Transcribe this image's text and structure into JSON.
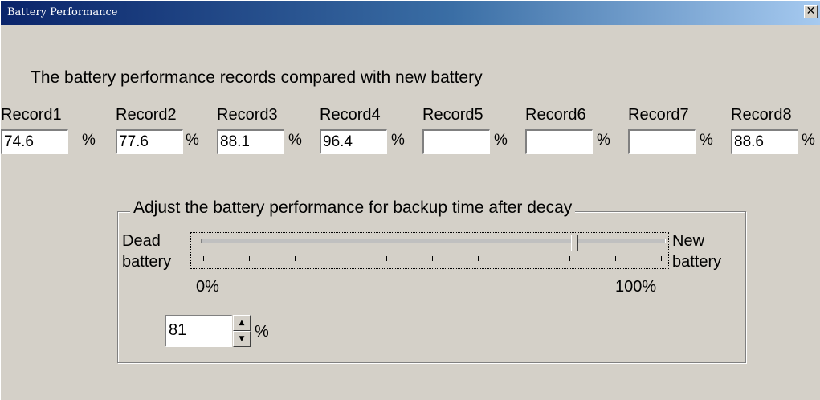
{
  "window": {
    "title": "Battery Performance",
    "close_glyph": "✕",
    "close_icon": "close-icon"
  },
  "intro_text": "The battery performance records compared with new battery",
  "records": [
    {
      "label": "Record1",
      "value": "74.6",
      "unit": "%"
    },
    {
      "label": "Record2",
      "value": "77.6",
      "unit": "%"
    },
    {
      "label": "Record3",
      "value": "88.1",
      "unit": "%"
    },
    {
      "label": "Record4",
      "value": "96.4",
      "unit": "%"
    },
    {
      "label": "Record5",
      "value": "",
      "unit": "%"
    },
    {
      "label": "Record6",
      "value": "",
      "unit": "%"
    },
    {
      "label": "Record7",
      "value": "",
      "unit": "%"
    },
    {
      "label": "Record8",
      "value": "88.6",
      "unit": "%"
    }
  ],
  "adjust_group": {
    "title": "Adjust the battery performance for backup time after decay",
    "left_label_line1": "Dead",
    "left_label_line2": "battery",
    "right_label_line1": "New",
    "right_label_line2": "battery",
    "scale_min_label": "0%",
    "scale_max_label": "100%",
    "slider_value_fraction": 0.81,
    "tick_count": 11,
    "spin_value": "81",
    "spin_unit": "%",
    "spin_up_icon": "arrow-up-icon",
    "spin_down_icon": "arrow-down-icon"
  },
  "colors": {
    "titlebar_start": "#0a246a",
    "titlebar_end": "#a6caf0",
    "face": "#d4d0c8"
  }
}
